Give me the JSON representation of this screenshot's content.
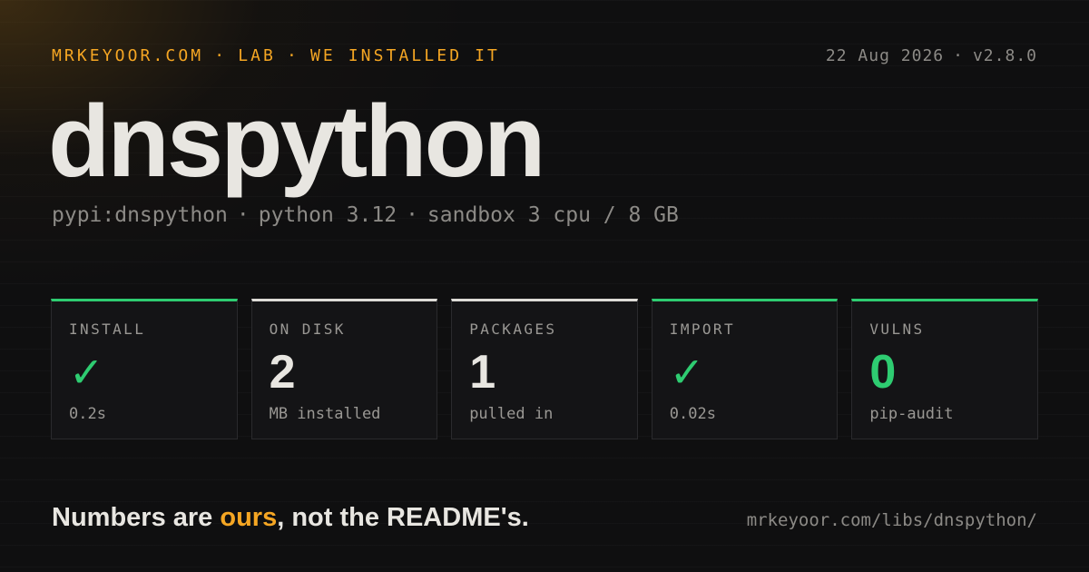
{
  "header": {
    "kicker": [
      "MRKEYOOR.COM",
      "LAB",
      "WE INSTALLED IT"
    ],
    "kicker_separator": "·",
    "date": "22 Aug 2026",
    "version": "v2.8.0",
    "meta_separator": "·"
  },
  "title": "dnspython",
  "subtitle": {
    "package": "pypi:dnspython",
    "python": "python 3.12",
    "sandbox": "sandbox 3 cpu / 8 GB",
    "separator": "·"
  },
  "cards": [
    {
      "label": "INSTALL",
      "value": "✓",
      "sub": "0.2s",
      "accent": "#2ecc71",
      "value_color": "#2ecc71",
      "icon": "check-icon"
    },
    {
      "label": "ON DISK",
      "value": "2",
      "sub": "MB installed",
      "accent": "#dddbd6",
      "value_color": "#e8e6e1"
    },
    {
      "label": "PACKAGES",
      "value": "1",
      "sub": "pulled in",
      "accent": "#dddbd6",
      "value_color": "#e8e6e1"
    },
    {
      "label": "IMPORT",
      "value": "✓",
      "sub": "0.02s",
      "accent": "#2ecc71",
      "value_color": "#2ecc71",
      "icon": "check-icon"
    },
    {
      "label": "VULNS",
      "value": "0",
      "sub": "pip-audit",
      "accent": "#2ecc71",
      "value_color": "#2ecc71"
    }
  ],
  "footer": {
    "tagline_start": "Numbers are ",
    "tagline_highlight": "ours",
    "tagline_end": ", not the README's.",
    "url": "mrkeyoor.com/libs/dnspython/"
  },
  "colors": {
    "background": "#0f0f10",
    "brand_accent": "#f5a623",
    "success": "#2ecc71",
    "text": "#e8e6e1",
    "muted": "#8c8a86"
  }
}
